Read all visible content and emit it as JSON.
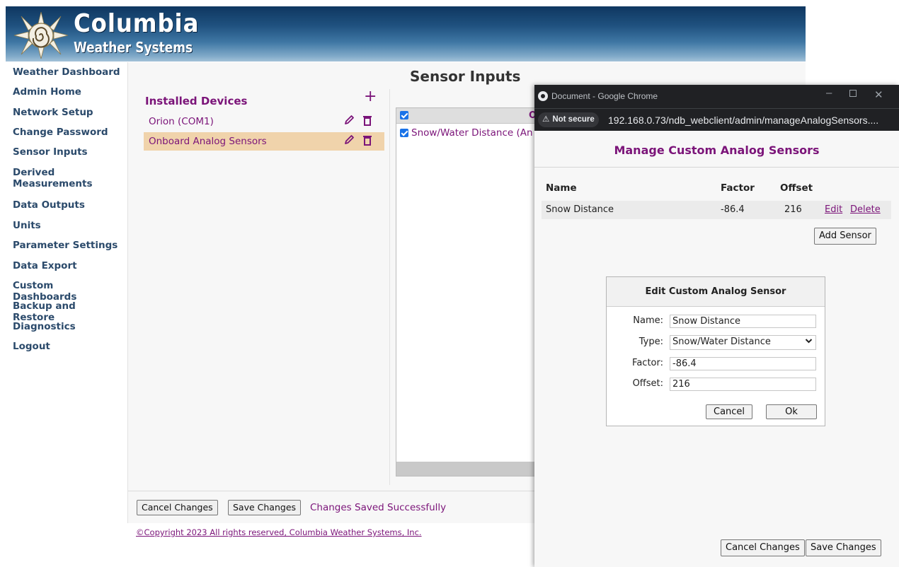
{
  "header": {
    "brand_line1": "Columbia",
    "brand_line2": "Weather Systems"
  },
  "sidebar": {
    "items": [
      {
        "label": "Weather Dashboard"
      },
      {
        "label": "Admin Home"
      },
      {
        "label": "Network Setup"
      },
      {
        "label": "Change Password"
      },
      {
        "label": "Sensor Inputs"
      },
      {
        "label": "Derived Measurements"
      },
      {
        "label": "Data Outputs"
      },
      {
        "label": "Units"
      },
      {
        "label": "Parameter Settings"
      },
      {
        "label": "Data Export"
      },
      {
        "label": "Custom Dashboards"
      },
      {
        "label": "Backup and Restore"
      },
      {
        "label": "Diagnostics"
      },
      {
        "label": "Logout"
      }
    ]
  },
  "main": {
    "title": "Sensor Inputs",
    "devices_heading": "Installed Devices",
    "add_glyph": "+",
    "devices": [
      {
        "label": "Orion (COM1)",
        "selected": false
      },
      {
        "label": "Onboard Analog Sensors",
        "selected": true
      }
    ],
    "measurements_header_initial": "O",
    "measurement_rows": [
      {
        "label": "Snow/Water Distance (An",
        "checked": true
      }
    ],
    "footer": {
      "cancel_label": "Cancel Changes",
      "save_label": "Save Changes",
      "status": "Changes Saved Successfully"
    },
    "copyright": "©Copyright 2023 All rights reserved, Columbia Weather Systems, Inc."
  },
  "popup": {
    "window_title": "Document - Google Chrome",
    "minimize_glyph": "–",
    "close_glyph": "✕",
    "not_secure_label": "Not secure",
    "warning_glyph": "⚠",
    "url": "192.168.0.73/ndb_webclient/admin/manageAnalogSensors....",
    "title": "Manage Custom Analog Sensors",
    "columns": {
      "name": "Name",
      "factor": "Factor",
      "offset": "Offset"
    },
    "sensors": [
      {
        "name": "Snow Distance",
        "factor": "-86.4",
        "offset": "216",
        "edit": "Edit",
        "delete": "Delete"
      }
    ],
    "add_sensor_label": "Add Sensor",
    "edit_dialog": {
      "title": "Edit Custom Analog Sensor",
      "name_label": "Name:",
      "name_value": "Snow Distance",
      "type_label": "Type:",
      "type_value": "Snow/Water Distance",
      "factor_label": "Factor:",
      "factor_value": "-86.4",
      "offset_label": "Offset:",
      "offset_value": "216",
      "cancel_label": "Cancel",
      "ok_label": "Ok"
    },
    "cancel_label": "Cancel Changes",
    "save_label": "Save Changes"
  },
  "colors": {
    "accent": "#7b1479",
    "nav_text": "#2b4a6b",
    "selected_row": "#f0d3ab",
    "banner_top": "#0f3760",
    "banner_bottom": "#a3c2d8"
  },
  "icons": {
    "edit": "pencil-icon",
    "delete": "trash-icon",
    "add": "plus-icon",
    "logo": "sun-spiral-logo"
  }
}
